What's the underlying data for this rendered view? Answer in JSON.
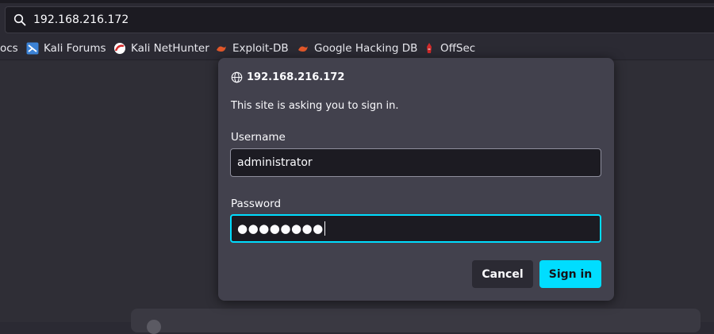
{
  "urlbar": {
    "url": "192.168.216.172",
    "icon": "search-icon"
  },
  "bookmarks": [
    {
      "label": "ocs",
      "icon": ""
    },
    {
      "label": "Kali Forums",
      "icon": "kali-forums-icon"
    },
    {
      "label": "Kali NetHunter",
      "icon": "kali-nethunter-icon"
    },
    {
      "label": "Exploit-DB",
      "icon": "exploit-db-icon"
    },
    {
      "label": "Google Hacking DB",
      "icon": "ghdb-icon"
    },
    {
      "label": "OffSec",
      "icon": "offsec-icon"
    }
  ],
  "dialog": {
    "host": "192.168.216.172",
    "message": "This site is asking you to sign in.",
    "username_label": "Username",
    "username_value": "administrator",
    "password_label": "Password",
    "password_masked": "●●●●●●●●",
    "cancel_label": "Cancel",
    "signin_label": "Sign in"
  },
  "colors": {
    "accent": "#00ddff",
    "dialog_bg": "#42414d",
    "page_bg": "#2b2a33"
  }
}
